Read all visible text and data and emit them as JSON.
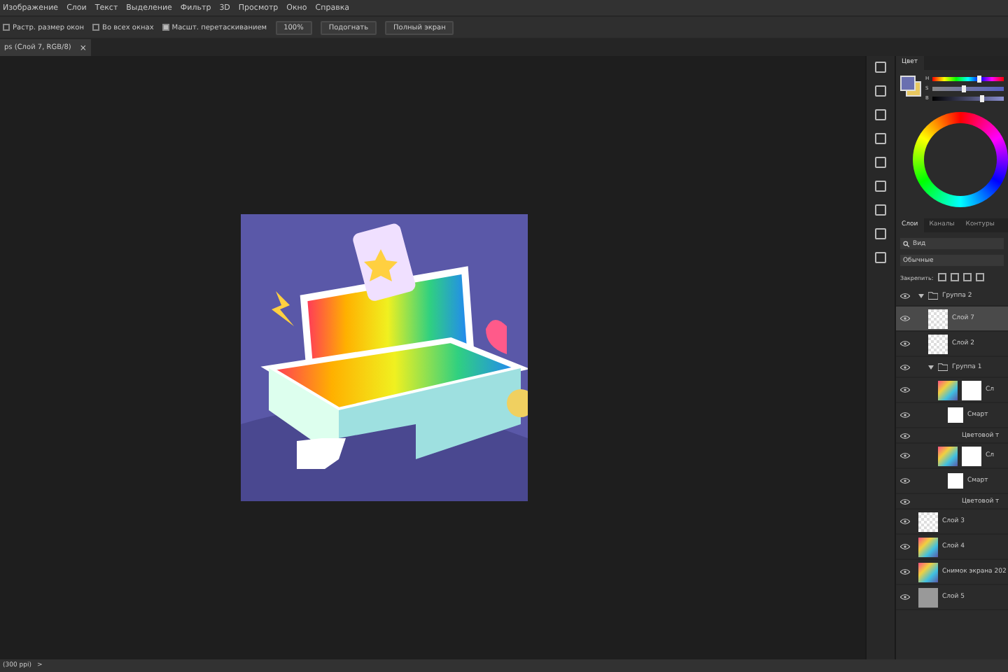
{
  "menu": [
    "Изображение",
    "Слои",
    "Текст",
    "Выделение",
    "Фильтр",
    "3D",
    "Просмотр",
    "Окно",
    "Справка"
  ],
  "options": [
    {
      "kind": "check",
      "label": "Растр. размер окон",
      "checked": false
    },
    {
      "kind": "check",
      "label": "Во всех окнах",
      "checked": false
    },
    {
      "kind": "check",
      "label": "Масшт. перетаскиванием",
      "checked": true
    },
    {
      "kind": "button",
      "label": "100%"
    },
    {
      "kind": "button",
      "label": "Подогнать"
    },
    {
      "kind": "button",
      "label": "Полный экран"
    }
  ],
  "doc_tab": {
    "title": "ps (Слой 7, RGB/8)",
    "close": "×"
  },
  "color_panel": {
    "tab": "Цвет",
    "sliders": [
      {
        "label": "H",
        "level": 0.66
      },
      {
        "label": "S",
        "level": 0.45
      },
      {
        "label": "B",
        "level": 0.69
      }
    ]
  },
  "layers_panel": {
    "tabs": [
      {
        "label": "Слои",
        "selected": true
      },
      {
        "label": "Каналы",
        "selected": false
      },
      {
        "label": "Контуры",
        "selected": false
      }
    ],
    "search": {
      "value": "Вид"
    },
    "blend_mode": "Обычные",
    "lock_label": "Закрепить:",
    "layers": [
      {
        "kind": "group",
        "name": "Группа 2",
        "expanded": true,
        "selected": false,
        "children": [
          {
            "kind": "layer",
            "name": "Слой 7",
            "selected": true
          },
          {
            "kind": "layer",
            "name": "Слой 2",
            "selected": false
          },
          {
            "kind": "group",
            "name": "Группа 1",
            "expanded": true,
            "selected": false,
            "children": [
              {
                "kind": "masked",
                "name": "Сл",
                "selected": false,
                "children": [
                  {
                    "kind": "filter_mask",
                    "name": "Смарт",
                    "selected": false
                  },
                  {
                    "kind": "filter",
                    "name": "Цветовой т",
                    "selected": false
                  }
                ]
              },
              {
                "kind": "masked",
                "name": "Сл",
                "selected": false,
                "children": [
                  {
                    "kind": "filter_mask",
                    "name": "Смарт",
                    "selected": false
                  },
                  {
                    "kind": "filter",
                    "name": "Цветовой т",
                    "selected": false
                  }
                ]
              }
            ]
          }
        ]
      },
      {
        "kind": "layer",
        "name": "Слой 3",
        "selected": false
      },
      {
        "kind": "image",
        "name": "Слой 4",
        "selected": false
      },
      {
        "kind": "image",
        "name": "Снимок экрана 202",
        "selected": false
      },
      {
        "kind": "fill",
        "name": "Слой 5",
        "selected": false
      }
    ]
  },
  "status": {
    "text": "(300 ppi)",
    "arrow": ">"
  }
}
